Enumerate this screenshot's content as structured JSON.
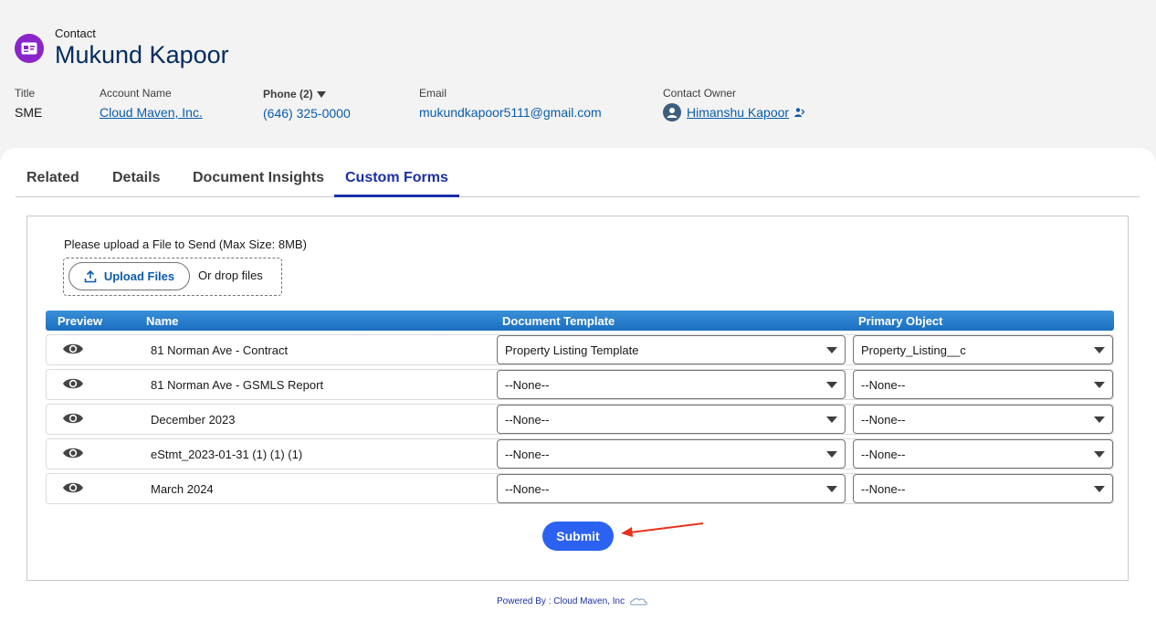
{
  "header": {
    "record_type": "Contact",
    "record_name": "Mukund Kapoor",
    "fields": {
      "title_label": "Title",
      "title_value": "SME",
      "account_label": "Account Name",
      "account_value": "Cloud Maven, Inc.",
      "phone_label": "Phone (2)",
      "phone_value": "(646) 325-0000",
      "email_label": "Email",
      "email_value": "mukundkapoor5111@gmail.com",
      "owner_label": "Contact Owner",
      "owner_value": "Himanshu Kapoor"
    }
  },
  "tabs": [
    {
      "label": "Related"
    },
    {
      "label": "Details"
    },
    {
      "label": "Document Insights"
    },
    {
      "label": "Custom Forms",
      "active": true
    }
  ],
  "upload": {
    "label": "Please upload a File to Send (Max Size: 8MB)",
    "button": "Upload Files",
    "drop_text": "Or drop files"
  },
  "table": {
    "columns": [
      "Preview",
      "Name",
      "Document Template",
      "Primary Object"
    ],
    "rows": [
      {
        "name": "81 Norman Ave - Contract",
        "template": "Property Listing Template",
        "object": "Property_Listing__c"
      },
      {
        "name": "81 Norman Ave - GSMLS Report",
        "template": "--None--",
        "object": "--None--"
      },
      {
        "name": "December 2023",
        "template": "--None--",
        "object": "--None--"
      },
      {
        "name": "eStmt_2023-01-31 (1) (1) (1)",
        "template": "--None--",
        "object": "--None--"
      },
      {
        "name": "March 2024",
        "template": "--None--",
        "object": "--None--"
      }
    ]
  },
  "submit_label": "Submit",
  "footer_text": "Powered By : Cloud Maven, Inc",
  "colors": {
    "accent": "#1b2fa8",
    "submit": "#2b62f2",
    "contact_icon": "#8a25c9",
    "arrow": "#e8321e"
  }
}
